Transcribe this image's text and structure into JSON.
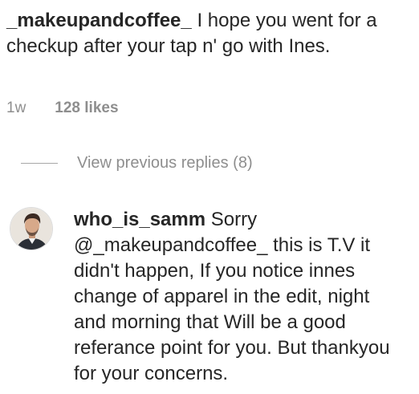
{
  "comment": {
    "username": "_makeupandcoffee_",
    "text": "I hope you went for a checkup after your tap n' go with Ines.",
    "time": "1w",
    "likes": "128 likes"
  },
  "replies_link": {
    "label": "View previous replies (8)"
  },
  "reply": {
    "username": "who_is_samm",
    "text_before_mention": "Sorry @",
    "mention": "_makeupandcoffee_",
    "text_after_mention": "this is T.V it didn't happen, If you notice innes change of apparel in the edit, night and morning that Will be a good referance point for you. But thankyou for your concerns.",
    "avatar_icon": "profile-photo-icon"
  }
}
